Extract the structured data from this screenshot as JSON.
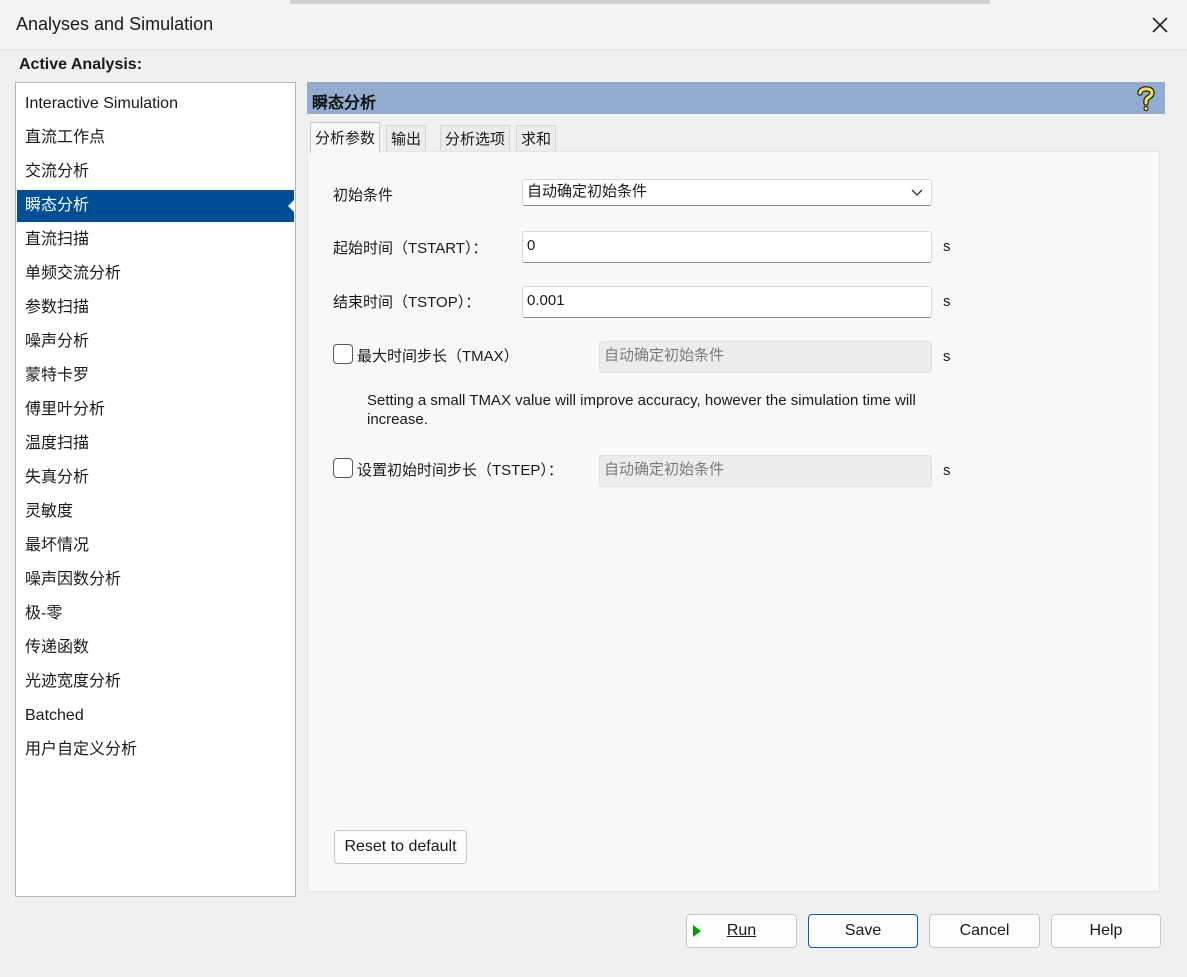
{
  "window": {
    "title": "Analyses and Simulation"
  },
  "active_analysis_label": "Active Analysis:",
  "analyses": [
    "Interactive Simulation",
    "直流工作点",
    "交流分析",
    "瞬态分析",
    "直流扫描",
    "单频交流分析",
    "参数扫描",
    "噪声分析",
    "蒙特卡罗",
    "傅里叶分析",
    "温度扫描",
    "失真分析",
    "灵敏度",
    "最坏情况",
    "噪声因数分析",
    "极-零",
    "传递函数",
    "光迹宽度分析",
    "Batched",
    "用户自定义分析"
  ],
  "selected_index": 3,
  "header": {
    "title": "瞬态分析",
    "help_icon": "question-mark-icon"
  },
  "tabs": [
    "分析参数",
    "输出",
    "分析选项",
    "求和"
  ],
  "active_tab": 0,
  "form": {
    "initial_conditions": {
      "label": "初始条件",
      "value": "自动确定初始条件"
    },
    "start_time": {
      "label": "起始时间（TSTART）：",
      "value": "0",
      "unit": "s"
    },
    "end_time": {
      "label": "结束时间（TSTOP）：",
      "value": "0.001",
      "unit": "s"
    },
    "max_step": {
      "label": "最大时间步长（TMAX）",
      "checked": false,
      "value": "自动确定初始条件",
      "unit": "s"
    },
    "note": "Setting a small TMAX value will improve accuracy, however the simulation time will increase.",
    "initial_step": {
      "label": "设置初始时间步长（TSTEP）：",
      "checked": false,
      "value": "自动确定初始条件",
      "unit": "s"
    }
  },
  "buttons": {
    "reset": "Reset to default",
    "run": "Run",
    "save": "Save",
    "cancel": "Cancel",
    "help": "Help"
  },
  "colors": {
    "selection": "#004f96",
    "header": "#91acd0",
    "accent": "#005fb8",
    "run_icon": "#00a000"
  }
}
